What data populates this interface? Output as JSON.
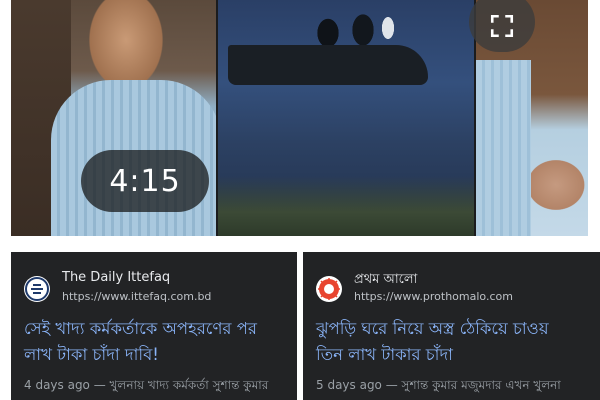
{
  "video": {
    "duration": "4:15",
    "expand_icon": "expand-icon"
  },
  "results": [
    {
      "source_name": "The Daily Ittefaq",
      "source_url": "https://www.ittefaq.com.bd",
      "logo_icon": "ittefaq-logo-icon",
      "headline_line1": "সেই খাদ্য কর্মকর্তাকে অপহরণের পর",
      "headline_line2": "লাখ টাকা চাঁদা দাবি!",
      "snippet": "4 days ago — খুলনায় খাদ্য কর্মকর্তা সুশান্ত কুমার"
    },
    {
      "source_name": "প্রথম আলো",
      "source_url": "https://www.prothomalo.com",
      "logo_icon": "prothomalo-logo-icon",
      "headline_line1": "ঝুপড়ি ঘরে নিয়ে অস্ত্র ঠেকিয়ে চাওয়",
      "headline_line2": "তিন লাখ টাকার চাঁদা",
      "snippet": "5 days ago — সুশান্ত কুমার মজুমদার এখন খুলনা"
    }
  ],
  "colors": {
    "card_bg": "#222325",
    "headline": "#8ab4f8",
    "prothomalo_accent": "#e8442f"
  }
}
